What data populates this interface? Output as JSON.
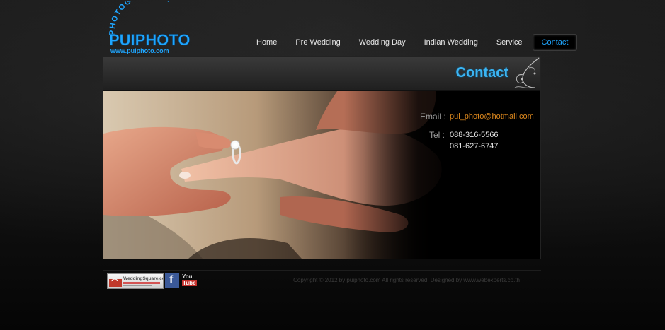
{
  "brand": {
    "arc_text": "PHOTOGRAPHER",
    "name": "PUIPHOTO",
    "url": "www.puiphoto.com",
    "color": "#1fa6ff"
  },
  "nav": {
    "items": [
      {
        "label": "Home"
      },
      {
        "label": "Pre Wedding"
      },
      {
        "label": "Wedding Day"
      },
      {
        "label": "Indian Wedding"
      },
      {
        "label": "Service"
      },
      {
        "label": "Contact",
        "active": true
      }
    ]
  },
  "page": {
    "title": "Contact"
  },
  "contact": {
    "email_label": "Email :",
    "email": "pui_photo@hotmail.com",
    "tel_label": "Tel :",
    "tel1": "088-316-5566",
    "tel2": "081-627-6747"
  },
  "footer": {
    "badges": [
      {
        "name": "weddingsquare",
        "label": "WeddingSquare.com"
      },
      {
        "name": "facebook",
        "label": "f"
      },
      {
        "name": "youtube",
        "label_top": "You",
        "label_bottom": "Tube"
      }
    ],
    "copyright": "Copyright © 2012 by puiphoto.com All rights reserved. Designed by www.webexperts.co.th"
  },
  "colors": {
    "accent_blue": "#3bb4f2",
    "email_orange": "#e08a1e",
    "facebook_blue": "#3b5998",
    "youtube_red": "#c4302b"
  }
}
